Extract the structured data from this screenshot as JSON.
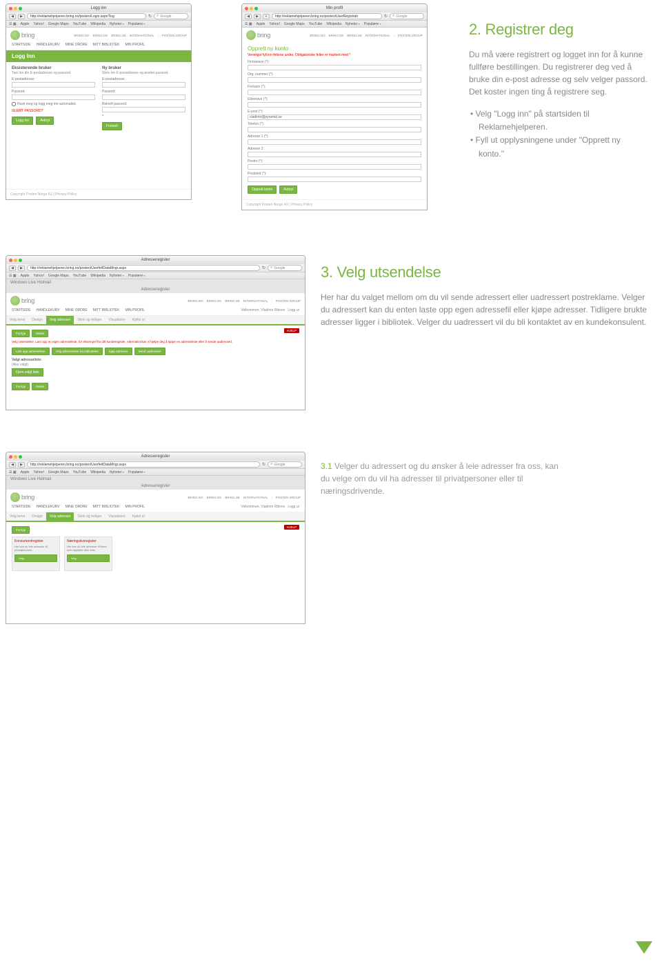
{
  "section2": {
    "heading": "2. Registrer deg",
    "body": "Du må være registrert og logget inn for å kunne fullføre bestillingen. Du registrerer deg ved å bruke din e-post adresse og selv velger passord. Det koster ingen ting å registrere seg.",
    "bullet1": "Velg \"Logg inn\" på startsiden til Reklamehjelperen.",
    "bullet2": "Fyll ut opplysningene under \"Opprett ny konto.\""
  },
  "section3": {
    "heading": "3. Velg utsendelse",
    "body": "Her har du valget mellom om du vil sende adressert eller uadressert postreklame. Velger du adressert kan du enten laste opp egen adressefil eller kjøpe adresser. Tidligere brukte adresser ligger i bibliotek. Velger du uadressert vil du bli kontaktet av en kundekonsulent."
  },
  "section31": {
    "lead": "3.1",
    "body": "  Velger du adressert og du ønsker å leie adresser fra oss, kan du velge om du vil ha adresser til privatpersoner eller til næringsdrivende."
  },
  "browser": {
    "loginTitle": "Logg inn",
    "profileTitle": "Min profil",
    "addressTitle": "Adresseregister",
    "urlLogin": "http://reklamehjelperen.bring.no/posten/Login.aspx?log",
    "urlProfile": "http://reklamehjelperen.bring.no/posten/UserRegistrati",
    "urlAddress": "http://reklamehjelperen.bring.no/posten/UserfeltDataMngr.aspx",
    "searchPlaceholder": "Google",
    "bookmarks": {
      "apple": "Apple",
      "yahoo": "Yahoo!",
      "gmaps": "Google Maps",
      "youtube": "YouTube",
      "wikipedia": "Wikipedia",
      "nyheter": "Nyheter",
      "populaere": "Populære"
    },
    "hotmail": "Windows Live Hotmail"
  },
  "bring": {
    "logo": "bring",
    "topLinks": {
      "no": "BRING.NO",
      "dk": "BRING.DK",
      "se": "BRING.SE",
      "int": "INTERNATIONAL",
      "group": "POSTEN GROUP"
    },
    "nav": {
      "start": "STARTSIDE",
      "handlekurv": "HANDLEKURV",
      "ordre": "MINE ORDRE",
      "bibliotek": "MITT BIBLIOTEK",
      "profil": "MIN PROFIL"
    },
    "welcome": "Velkommen, Vladimir Ribnov",
    "loggut": "Logg ut",
    "pageTitleAddress": "Adresseregister"
  },
  "login": {
    "bar": "Logg Inn",
    "left": {
      "head": "Eksisterende bruker",
      "sub": "Tast inn din E-postadresse og passord.",
      "email": "E-postadresse:",
      "pwd": "Passord:",
      "remember": "Husk meg og logg meg inn automatisk",
      "forgot": "GLEMT PASSORD?",
      "btnLogin": "Logg inn",
      "btnCancel": "Avbryt"
    },
    "right": {
      "head": "Ny bruker",
      "sub": "Skriv inn E-postadresse og ønsket passord.",
      "email": "E-postadresse:",
      "pwd": "Passord:",
      "pwd2": "Bekreft passord:",
      "btn": "Fortsett"
    }
  },
  "register": {
    "title": "Opprett ny konto",
    "note": "Vennligst fyll inn feltene under. Obligatoriske felter er markert med *",
    "fields": {
      "firma": "Firmanavn (*):",
      "org": "Org. nummer (*):",
      "fornavn": "Fornavn (*):",
      "etternavn": "Etternavn (*):",
      "epost": "E-post (*):",
      "epostVal": "vladimir@pyramid.se",
      "telefon": "Telefon (*):",
      "adr1": "Adresse 1 (*):",
      "adr2": "Adresse 2:",
      "postnr": "Postnr (*):",
      "poststed": "Poststed (*):"
    },
    "btnCreate": "Opprett konto",
    "btnCancel": "Avbryt"
  },
  "wizard": {
    "tabs": {
      "t1": "Velg tema",
      "t2": "Design",
      "t3": "Velg adresser",
      "t4": "Skriv og rediger",
      "t5": "Visualisere",
      "t6": "Kjøkk ut"
    },
    "btnPrev": "Forrige",
    "btnNext": "Neste",
    "hjelp": "HJELP"
  },
  "step3": {
    "line": "Velg utsendelse. Last opp en egen adresseliste, for eksempel fra ditt kunderegister. Alternativt kan vi hjelpe deg å kjøpe en adresseliste eller å sende uadressert.",
    "b1": "Last opp adresseliste",
    "b2": "Velg adresseliste fra biblioteket",
    "b3": "Kjøp adresser",
    "b4": "Send uadressert",
    "selHead": "Valgt adresseliste:",
    "selVal": "(ikke valgt)",
    "btnNew": "Fjern valgt liste"
  },
  "step31": {
    "btn": "Forrige",
    "tile1": {
      "head": "Konsumentregister",
      "text": "Her kan du leie adresser til privatpersoner."
    },
    "tile2": {
      "head": "Næringslivsregister",
      "text": "Her kan du leie adresser til firma som oppfyller dine krav."
    },
    "tileBtn": "Velg"
  },
  "footer": "Copyright Posten Norge AS | Privacy Policy"
}
